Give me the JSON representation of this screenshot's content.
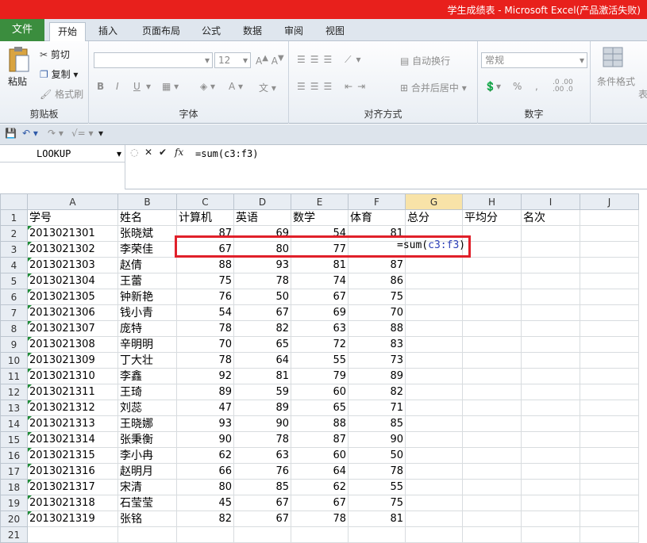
{
  "window": {
    "title": "学生成绩表 - Microsoft Excel(产品激活失败)"
  },
  "ribbon_tabs": [
    "文件",
    "开始",
    "插入",
    "页面布局",
    "公式",
    "数据",
    "审阅",
    "视图"
  ],
  "clipboard": {
    "paste": "粘贴",
    "cut": "剪切",
    "copy": "复制",
    "format_painter": "格式刷",
    "label": "剪贴板"
  },
  "font": {
    "size": "12",
    "label": "字体",
    "bold": "B",
    "italic": "I",
    "underline": "U"
  },
  "alignment": {
    "wrap": "自动换行",
    "merge": "合并后居中",
    "label": "对齐方式"
  },
  "number": {
    "format": "常规",
    "percent": "%",
    "comma": ",",
    "label": "数字"
  },
  "styles": {
    "conditional": "条件格式",
    "cut_label": "表"
  },
  "formula_bar": {
    "name_box": "LOOKUP",
    "fx": "fx",
    "formula": "=sum(c3:f3)"
  },
  "columns": [
    "A",
    "B",
    "C",
    "D",
    "E",
    "F",
    "G",
    "H",
    "I",
    "J"
  ],
  "headers": [
    "学号",
    "姓名",
    "计算机",
    "英语",
    "数学",
    "体育",
    "总分",
    "平均分",
    "名次"
  ],
  "rows": [
    [
      "2013021301",
      "张晓斌",
      "87",
      "69",
      "54",
      "81"
    ],
    [
      "2013021302",
      "李荣佳",
      "67",
      "80",
      "77",
      ""
    ],
    [
      "2013021303",
      "赵倩",
      "88",
      "93",
      "81",
      "87"
    ],
    [
      "2013021304",
      "王蕾",
      "75",
      "78",
      "74",
      "86"
    ],
    [
      "2013021305",
      "钟新艳",
      "76",
      "50",
      "67",
      "75"
    ],
    [
      "2013021306",
      "钱小青",
      "54",
      "67",
      "69",
      "70"
    ],
    [
      "2013021307",
      "庞特",
      "78",
      "82",
      "63",
      "88"
    ],
    [
      "2013021308",
      "辛明明",
      "70",
      "65",
      "72",
      "83"
    ],
    [
      "2013021309",
      "丁大壮",
      "78",
      "64",
      "55",
      "73"
    ],
    [
      "2013021310",
      "李鑫",
      "92",
      "81",
      "79",
      "89"
    ],
    [
      "2013021311",
      "王琦",
      "89",
      "59",
      "60",
      "82"
    ],
    [
      "2013021312",
      "刘蕊",
      "47",
      "89",
      "65",
      "71"
    ],
    [
      "2013021313",
      "王晓娜",
      "93",
      "90",
      "88",
      "85"
    ],
    [
      "2013021314",
      "张秉衡",
      "90",
      "78",
      "87",
      "90"
    ],
    [
      "2013021315",
      "李小冉",
      "62",
      "63",
      "60",
      "50"
    ],
    [
      "2013021316",
      "赵明月",
      "66",
      "76",
      "64",
      "78"
    ],
    [
      "2013021317",
      "宋清",
      "80",
      "85",
      "62",
      "55"
    ],
    [
      "2013021318",
      "石莹莹",
      "45",
      "67",
      "67",
      "75"
    ],
    [
      "2013021319",
      "张铭",
      "82",
      "67",
      "78",
      "81"
    ]
  ],
  "cell_edit": {
    "prefix": "=sum(",
    "ref": "c3:f3",
    "suffix": ")"
  }
}
